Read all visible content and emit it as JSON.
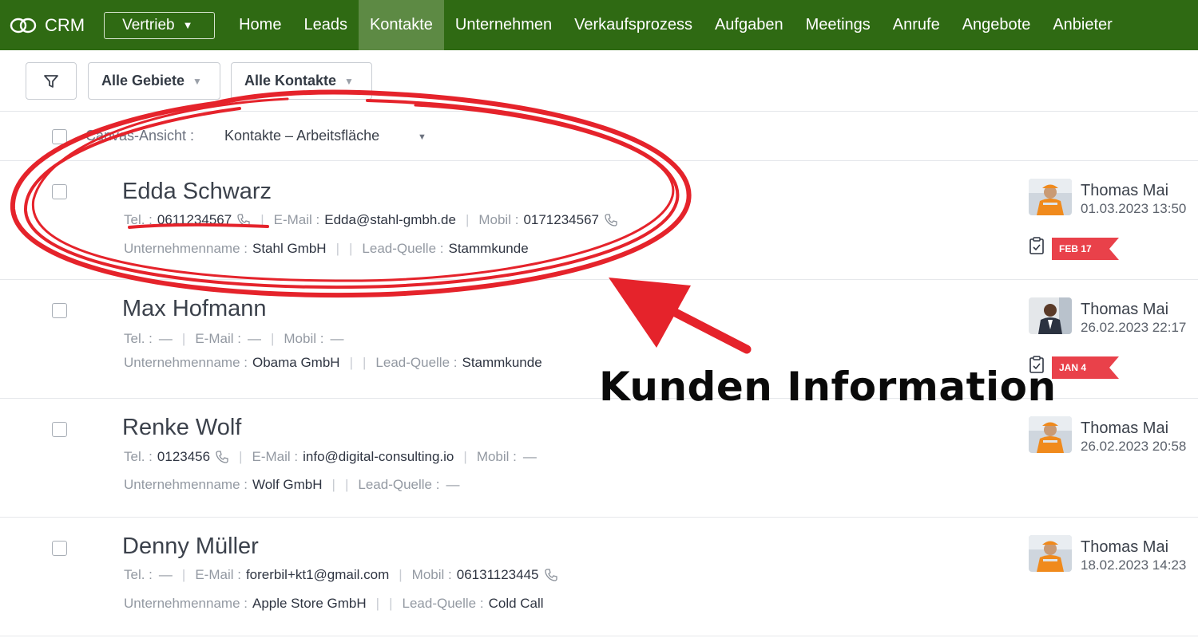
{
  "header": {
    "app_title": "CRM",
    "module": "Vertrieb",
    "nav": [
      "Home",
      "Leads",
      "Kontakte",
      "Unternehmen",
      "Verkaufsprozess",
      "Aufgaben",
      "Meetings",
      "Anrufe",
      "Angebote",
      "Anbieter"
    ],
    "active_nav": "Kontakte",
    "colors": {
      "nav_bg": "#2f6a13",
      "nav_active": "#5d8a44",
      "flag": "#e9414a",
      "annotation": "#e5232b"
    }
  },
  "filters": {
    "filter_icon": "filter-icon",
    "territory": "Alle Gebiete",
    "view": "Alle Kontakte"
  },
  "view_header": {
    "label": "Canvas-Ansicht :",
    "value": "Kontakte – Arbeitsfläche"
  },
  "labels": {
    "tel": "Tel. :",
    "email": "E-Mail :",
    "mobile": "Mobil :",
    "company": "Unternehmenname :",
    "lead_source": "Lead-Quelle :",
    "empty": "—"
  },
  "contacts": [
    {
      "name": "Edda Schwarz",
      "tel": "0611234567",
      "email": "Edda@stahl-gmbh.de",
      "mobile": "0171234567",
      "company": "Stahl GmbH",
      "lead_source": "Stammkunde",
      "owner": "Thomas Mai",
      "modified": "01.03.2023 13:50",
      "due": "FEB 17"
    },
    {
      "name": "Max Hofmann",
      "tel": "—",
      "email": "—",
      "mobile": "—",
      "company": "Obama GmbH",
      "lead_source": "Stammkunde",
      "owner": "Thomas Mai",
      "modified": "26.02.2023 22:17",
      "due": "JAN 4"
    },
    {
      "name": "Renke Wolf",
      "tel": "0123456",
      "email": "info@digital-consulting.io",
      "mobile": "—",
      "company": "Wolf GmbH",
      "lead_source": "—",
      "owner": "Thomas Mai",
      "modified": "26.02.2023 20:58",
      "due": ""
    },
    {
      "name": "Denny Müller",
      "tel": "—",
      "email": "forerbil+kt1@gmail.com",
      "mobile": "06131123445",
      "company": "Apple Store GmbH",
      "lead_source": "Cold Call",
      "owner": "Thomas Mai",
      "modified": "18.02.2023 14:23",
      "due": ""
    }
  ],
  "annotation": {
    "text": "Kunden Information"
  }
}
